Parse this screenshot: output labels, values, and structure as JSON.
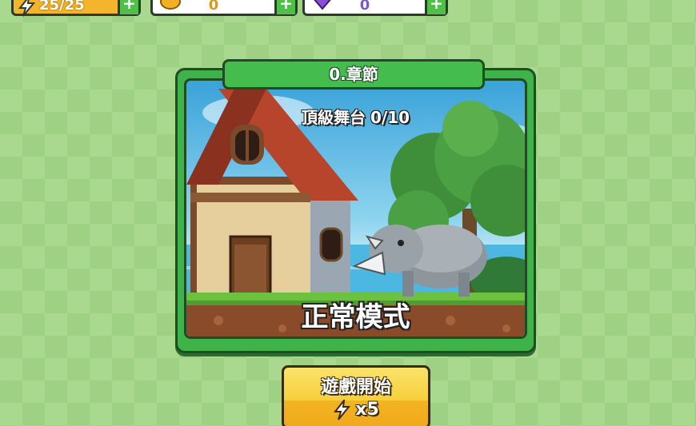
{
  "resources": {
    "energy": {
      "value": "25/25",
      "icon": "lightning-icon",
      "color": "#f4b42b"
    },
    "gold": {
      "value": "0",
      "icon": "coin-icon",
      "color": "#f2b025"
    },
    "gems": {
      "value": "0",
      "icon": "gem-icon",
      "color": "#8a4fd6"
    },
    "plus_label": "+"
  },
  "chapter": {
    "number": "0.",
    "title": "章節"
  },
  "stage": {
    "name": "頂級舞台",
    "progress": "0/10",
    "mode": "正常模式"
  },
  "start_button": {
    "label": "遊戲開始",
    "cost": "x5",
    "icon": "lightning-icon"
  },
  "colors": {
    "card_green": "#3fb249",
    "button_yellow": "#f7cf3c",
    "background": "#a9d98f"
  }
}
